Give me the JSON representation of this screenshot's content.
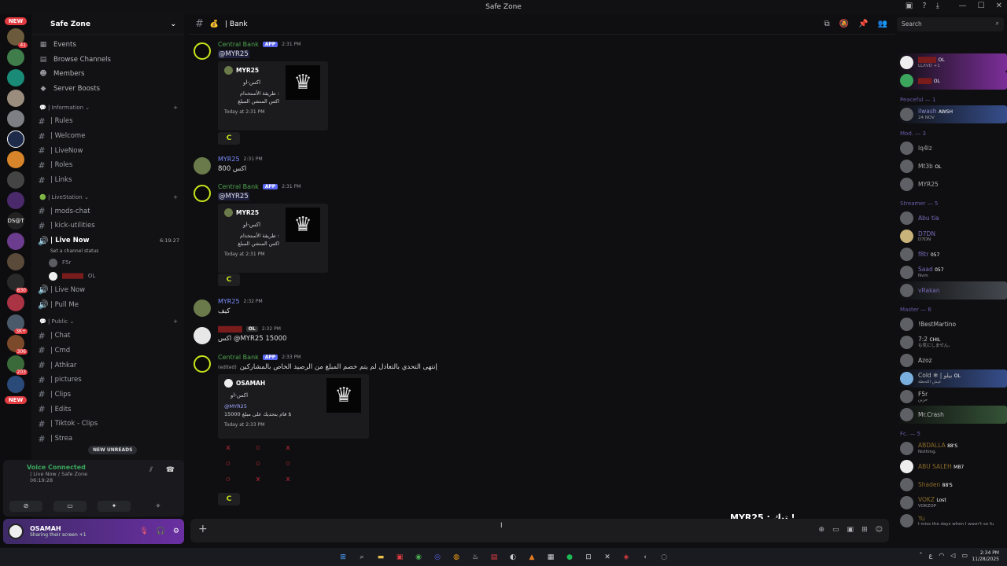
{
  "window": {
    "title": "Safe Zone",
    "icons": [
      "inbox-icon",
      "help-icon",
      "download-icon"
    ]
  },
  "rail": {
    "new_top": "NEW",
    "new_bottom": "NEW",
    "counts": [
      "41",
      "830",
      "3K+",
      "306",
      "203"
    ]
  },
  "guild": {
    "name": "Safe Zone"
  },
  "nav": [
    {
      "label": "Events",
      "icon": "calendar-icon"
    },
    {
      "label": "Browse Channels",
      "icon": "browse-icon"
    },
    {
      "label": "Members",
      "icon": "members-icon"
    },
    {
      "label": "Server Boosts",
      "icon": "boost-icon"
    }
  ],
  "categories": {
    "information": "Information",
    "livestation": "LiveStation",
    "public": "Public"
  },
  "channels_info": [
    "| Rules",
    "| Welcome",
    "| LiveNow",
    "| Roles",
    "| Links"
  ],
  "channels_live": {
    "mods_chat": "| mods-chat",
    "kick_utilities": "| kick-utilities",
    "live_now": "| Live Now",
    "live_now_time": "6:19:27",
    "status_hint": "Set a channel status",
    "voice_users": [
      "F5r",
      ""
    ],
    "voice_tag": "OL",
    "live_now_2": "| Live Now",
    "pull_me": "| Pull Me"
  },
  "channels_public": [
    "| Chat",
    "| Cmd",
    "| Athkar",
    "| pictures",
    "| Clips",
    "| Edits",
    "| Tiktok - Clips",
    "| Strea"
  ],
  "new_unreads": "NEW UNREADS",
  "voice": {
    "title": "Voice Connected",
    "channel": "| Live Now / Safe Zone",
    "time": "06:19:28"
  },
  "user": {
    "name": "OSAMAH",
    "status": "Sharing their screen +1"
  },
  "channel": {
    "name": "| Bank"
  },
  "search": {
    "placeholder": "Search"
  },
  "messages": [
    {
      "author": "Central Bank",
      "tag": "APP",
      "time": "2:31 PM",
      "body": "@MYR25",
      "embed": {
        "author": "MYR25",
        "desc": "اكس-او",
        "line1": "طريقة الأستخدام :",
        "line2": "اكس المنشن المبلغ",
        "footer": "Today at 2:31 PM"
      }
    },
    {
      "author": "MYR25",
      "time": "2:31 PM",
      "body": "اكس 800"
    },
    {
      "author": "Central Bank",
      "tag": "APP",
      "time": "2:31 PM",
      "body": "@MYR25",
      "embed": {
        "author": "MYR25",
        "desc": "اكس-او",
        "line1": "طريقة الأستخدام :",
        "line2": "اكس المنشن المبلغ",
        "footer": "Today at 2:31 PM"
      }
    },
    {
      "author": "MYR25",
      "time": "2:32 PM",
      "body": "كيف"
    },
    {
      "author": "",
      "tag": "OL",
      "time": "2:32 PM",
      "body": "اكس @MYR25 15000"
    },
    {
      "author": "Central Bank",
      "tag": "APP",
      "time": "2:33 PM",
      "edited": "(edited)",
      "body": "إنتهى التحدي بالتعادل لم يتم خصم المبلغ من الرصيد الخاص بالمشاركين",
      "embed": {
        "author": "OSAMAH",
        "desc": "اكس-او",
        "line1": "@MYR25",
        "line2": "قام  بتحديك على مبلغ  15000 $",
        "footer": "Today at 2:33 PM"
      }
    }
  ],
  "board": [
    "x",
    "o",
    "x",
    "o",
    "o",
    "o",
    "o",
    "x",
    "x"
  ],
  "stream_overlay": "MYR25 : تبك !",
  "members": {
    "top": [
      {
        "name": "",
        "tag": "OL",
        "sub": "LLXVD +1"
      },
      {
        "name": "",
        "tag": "OL",
        "sub": ""
      }
    ],
    "peaceful_title": "Peaceful — 1",
    "peaceful": [
      {
        "name": "ilwash",
        "tag": "AWSH",
        "sub": "24 NOV"
      }
    ],
    "mod_title": "Mod. — 3",
    "mod": [
      {
        "name": "lq4lz",
        "sub": ""
      },
      {
        "name": "Mt3b",
        "tag": "OL",
        "sub": ""
      },
      {
        "name": "MYR25",
        "sub": ""
      }
    ],
    "streamer_title": "Streamer — 5",
    "streamer": [
      {
        "name": "Abu tia",
        "sub": ""
      },
      {
        "name": "D7DN",
        "sub": "D7DN"
      },
      {
        "name": "f8tr",
        "tag": "057",
        "sub": ""
      },
      {
        "name": "Saad",
        "tag": "057",
        "sub": "Nvm"
      },
      {
        "name": "vRakan",
        "sub": ""
      }
    ],
    "master_title": "Master — 6",
    "master": [
      {
        "name": "!BestMartino",
        "sub": ""
      },
      {
        "name": "7:2",
        "tag": "CHIL",
        "sub": "も気にしません。"
      },
      {
        "name": "Azoz",
        "sub": ""
      },
      {
        "name": "Cold ❄ | بيلو",
        "tag": "OL",
        "sub": "عيش اللحظة"
      },
      {
        "name": "F5r",
        "sub": "حزين"
      },
      {
        "name": "Mr.Crash",
        "sub": ""
      }
    ],
    "fc_title": "Fc. — 5",
    "fc": [
      {
        "name": "ABDALLA",
        "tag": "88'S",
        "sub": "Nothing."
      },
      {
        "name": "ABU SALEH",
        "tag": "MB7",
        "sub": ""
      },
      {
        "name": "Shaden",
        "tag": "88'S",
        "sub": ""
      },
      {
        "name": "VOKZ",
        "tag": "Lost",
        "sub": "VOKZOP"
      },
      {
        "name": "Yu",
        "sub": "I miss the days when I wasn't so fu"
      }
    ]
  },
  "taskbar": {
    "time": "2:34 PM",
    "date": "11/28/2025",
    "lang": "ع"
  },
  "colors": {
    "accent": "#5865f2",
    "bank": "#c6e21b",
    "online": "#3ba55d",
    "danger": "#e23b41"
  }
}
